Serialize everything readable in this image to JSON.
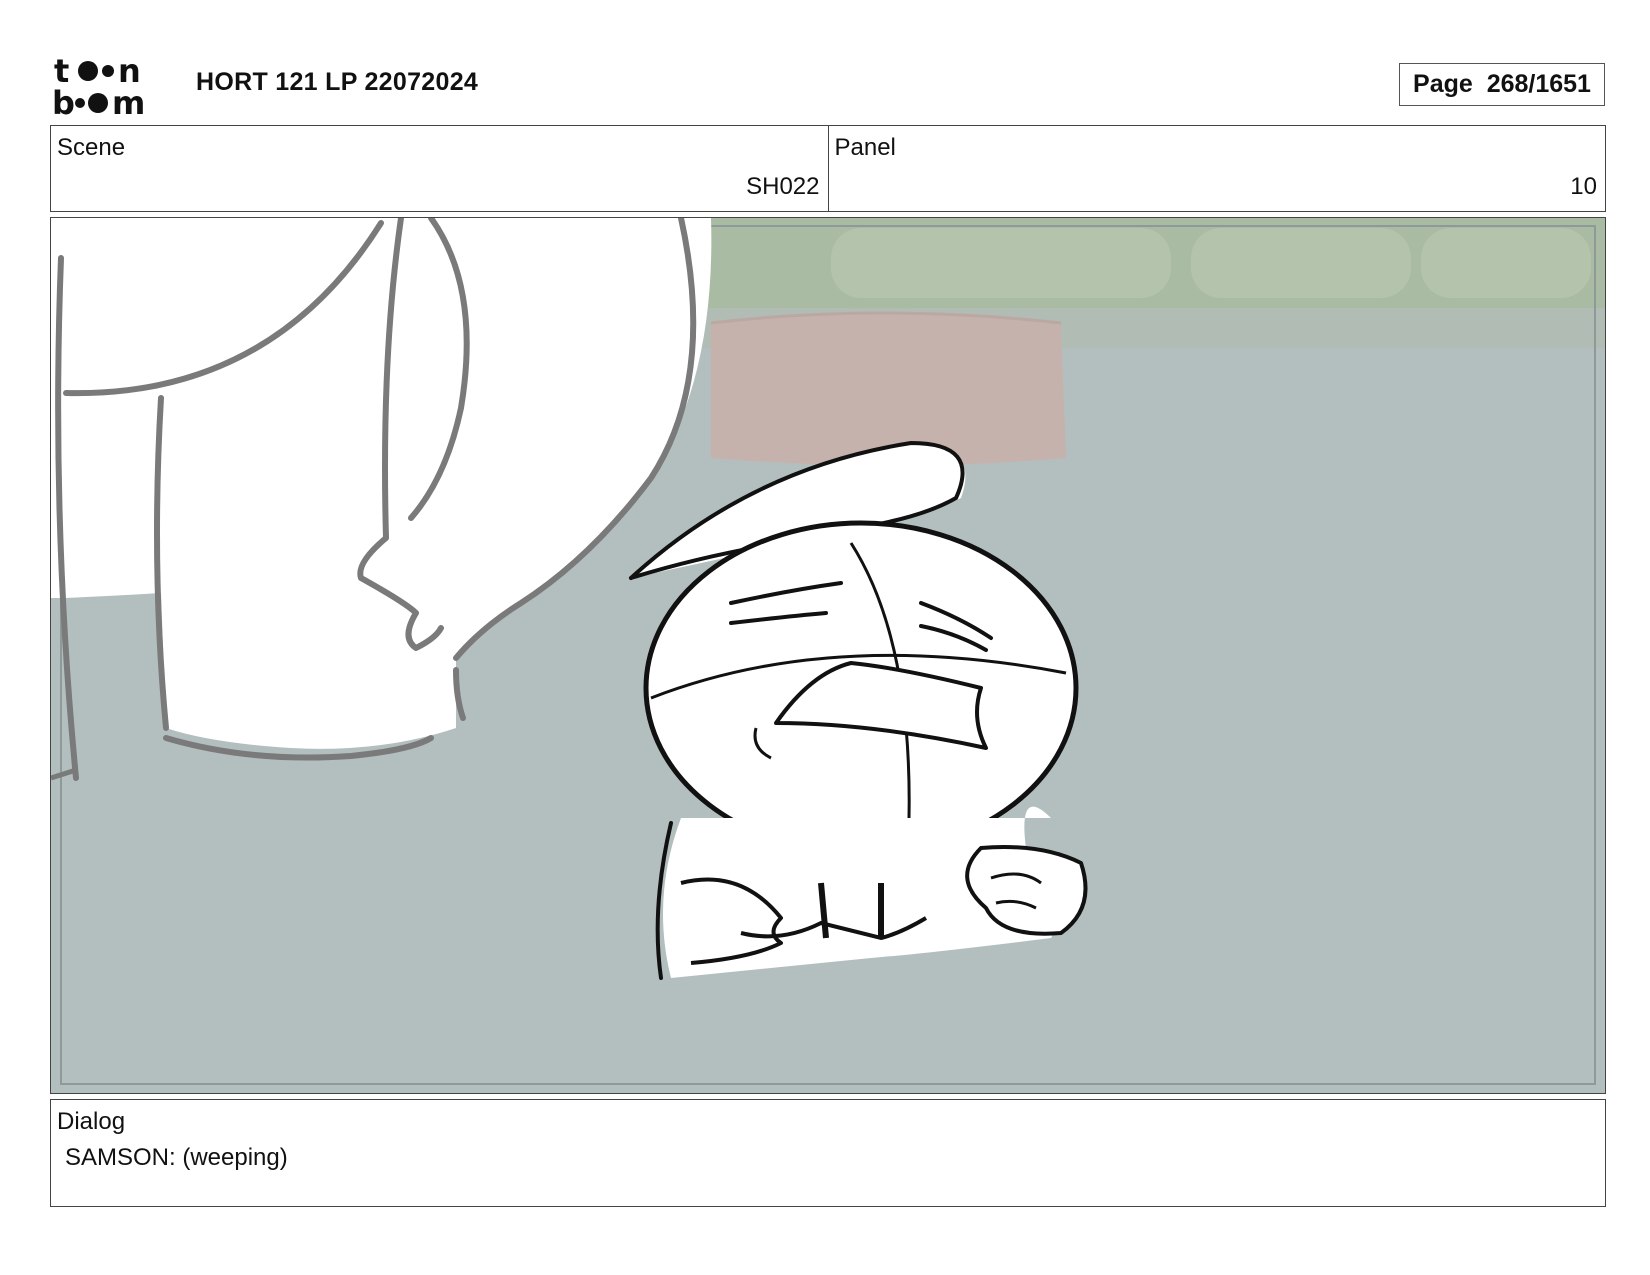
{
  "header": {
    "logo_text": "toon boom",
    "title": "HORT 121 LP 22072024",
    "page_label": "Page",
    "page_value": "268/1651"
  },
  "scene": {
    "label": "Scene",
    "value": "SH022"
  },
  "panel": {
    "label": "Panel",
    "value": "10"
  },
  "dialog": {
    "label": "Dialog",
    "text": "SAMSON: (weeping)"
  },
  "colors": {
    "floor": "#b3bfbf",
    "wall_green": "#a9bba3",
    "stool": "#c8b3ad",
    "sketch_gray": "#7a7a7a",
    "ink": "#111111"
  }
}
